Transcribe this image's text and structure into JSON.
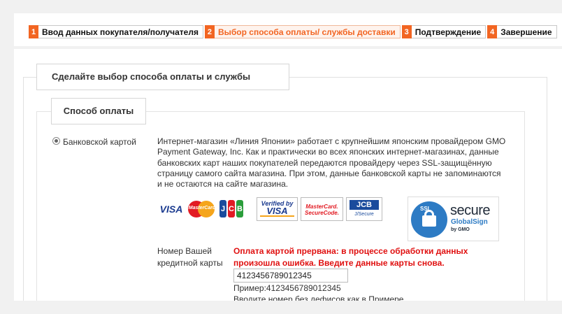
{
  "steps": [
    {
      "num": "1",
      "label": "Ввод данных покупателя/получателя"
    },
    {
      "num": "2",
      "label": "Выбор способа оплаты/ службы доставки"
    },
    {
      "num": "3",
      "label": "Подтверждение"
    },
    {
      "num": "4",
      "label": "Завершение"
    }
  ],
  "section": {
    "title": "Сделайте выбор способа оплаты и службы доставки"
  },
  "payment": {
    "title": "Способ оплаты",
    "option_label": "Банковской картой",
    "description": "Интернет-магазин «Линия Японии» работает с крупнейшим японским провайдером GMO Payment Gateway, Inc. Как и практически во всех японских интернет-магазинах, данные банковских карт наших покупателей передаются провайдеру через SSL-защищённую страницу самого сайта магазина. При этом, данные банковской карты не запоминаются и не остаются на сайте магазина."
  },
  "logos": {
    "visa": "VISA",
    "mastercard": "MasterCard",
    "jcb": [
      "J",
      "C",
      "B"
    ],
    "verified_small": "Verified by",
    "verified_big": "VISA",
    "mc_secure_1": "MasterCard.",
    "mc_secure_2": "SecureCode.",
    "jcb_secure_top": "JCB",
    "jcb_secure_bottom": "J/Secure",
    "ssl": "SSL",
    "secure": "secure",
    "globalsign": "GlobalSign",
    "by_gmo": "by GMO"
  },
  "card_form": {
    "label": "Номер Вашей кредитной карты",
    "error": "Оплата картой прервана: в процессе обработки данных произошла ошибка. Введите данные карты снова.",
    "value": "4123456789012345",
    "example": "Пример:4123456789012345",
    "hint": "Вводите номер без дефисов как в Примере"
  },
  "colors": {
    "accent": "#f26522",
    "error": "#e01010"
  }
}
